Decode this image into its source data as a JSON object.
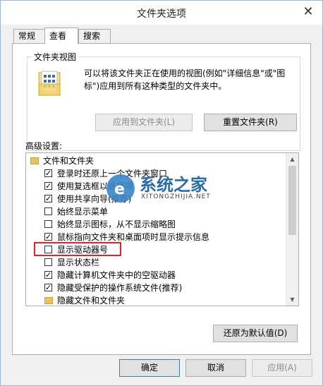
{
  "window": {
    "title": "文件夹选项",
    "close_glyph": "✕"
  },
  "tabs": [
    {
      "label": "常规"
    },
    {
      "label": "查看"
    },
    {
      "label": "搜索"
    }
  ],
  "folder_view": {
    "title": "文件夹视图",
    "description": "可以将该文件夹正在使用的视图(例如\"详细信息\"或\"图标\")应用到所有这种类型的文件夹中。",
    "apply_button": "应用到文件夹(L)",
    "reset_button": "重置文件夹(R)"
  },
  "advanced": {
    "label": "高级设置:",
    "items": [
      {
        "label": "文件和文件夹",
        "type": "folder",
        "checked": false
      },
      {
        "label": "登录时还原上一个文件夹窗口",
        "type": "checkbox",
        "checked": true
      },
      {
        "label": "使用复选框以选择项",
        "type": "checkbox",
        "checked": true
      },
      {
        "label": "使用共享向导(推荐)",
        "type": "checkbox",
        "checked": true
      },
      {
        "label": "始终显示菜单",
        "type": "checkbox",
        "checked": false
      },
      {
        "label": "始终显示图标，从不显示缩略图",
        "type": "checkbox",
        "checked": false
      },
      {
        "label": "鼠标指向文件夹和桌面项时显示提示信息",
        "type": "checkbox",
        "checked": true
      },
      {
        "label": "显示驱动器号",
        "type": "checkbox",
        "checked": false
      },
      {
        "label": "显示状态栏",
        "type": "checkbox",
        "checked": false
      },
      {
        "label": "隐藏计算机文件夹中的空驱动器",
        "type": "checkbox",
        "checked": true
      },
      {
        "label": "隐藏受保护的操作系统文件(推荐)",
        "type": "checkbox",
        "checked": true
      },
      {
        "label": "隐藏文件和文件夹",
        "type": "folder",
        "checked": false
      }
    ],
    "restore_button": "还原为默认值(D)"
  },
  "footer": {
    "ok": "确定",
    "cancel": "取消",
    "apply": "应用(A)"
  },
  "watermark": {
    "text": "系统之家",
    "sub": "XITONGZHIJIA.NET"
  },
  "colors": {
    "highlight": "#e0232e",
    "accent": "#3c7fb1"
  }
}
